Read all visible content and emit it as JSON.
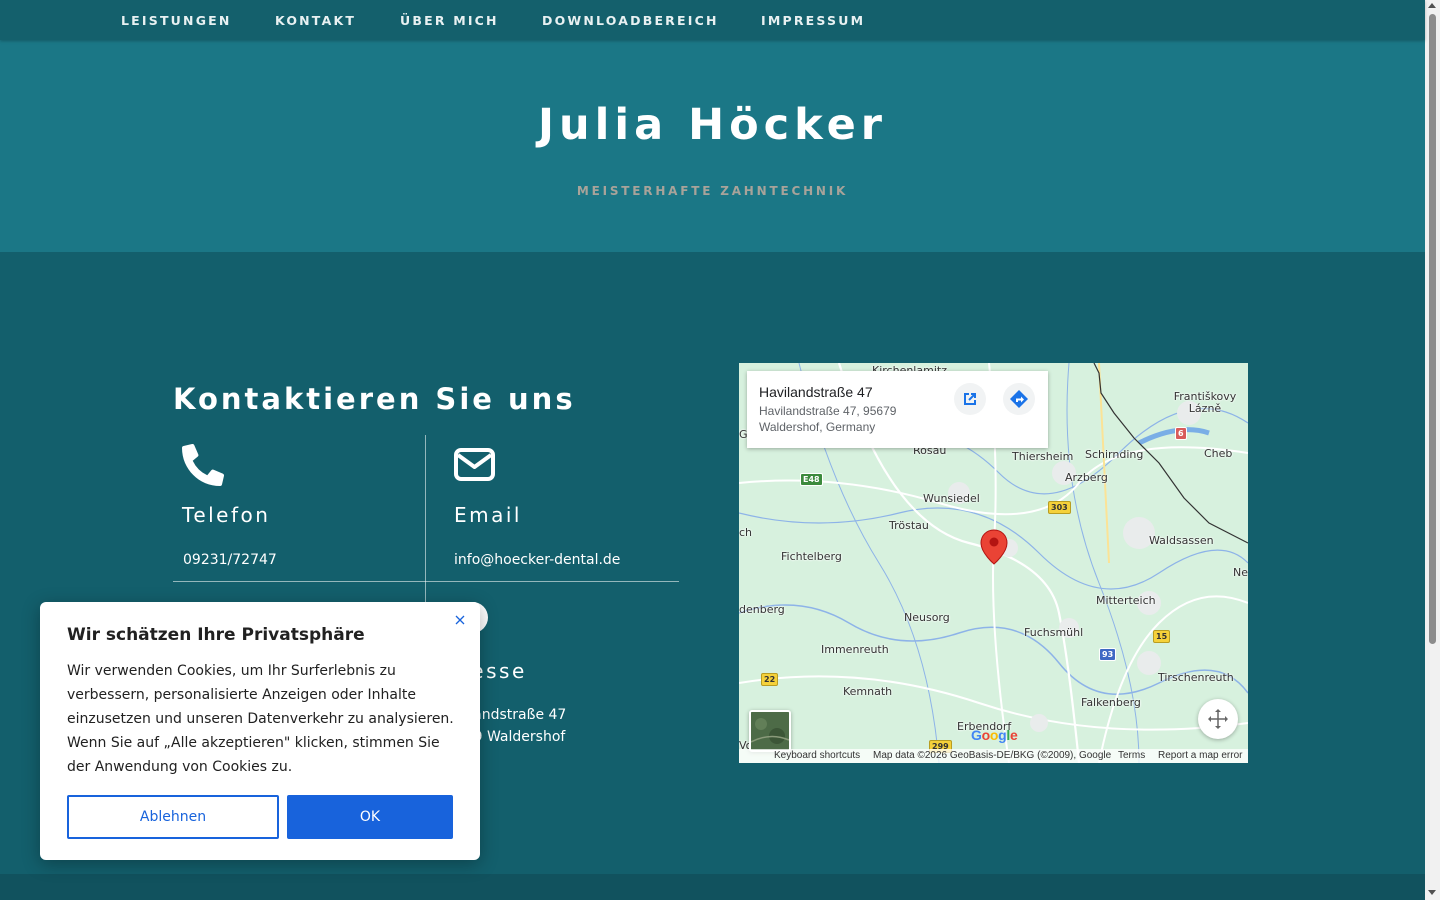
{
  "nav": {
    "items": [
      "LEISTUNGEN",
      "KONTAKT",
      "ÜBER MICH",
      "DOWNLOADBEREICH",
      "IMPRESSUM"
    ]
  },
  "hero": {
    "title": "Julia Höcker",
    "subtitle": "MEISTERHAFTE ZAHNTECHNIK"
  },
  "contact": {
    "title": "Kontaktieren Sie uns",
    "phone": {
      "icon": "phone-icon",
      "label": "Telefon",
      "value": "09231/72747"
    },
    "email": {
      "icon": "envelope-icon",
      "label": "Email",
      "value": "info@hoecker-dental.de"
    },
    "address": {
      "label": "Adresse",
      "line1": "Havilandstraße 47",
      "line2": "95679 Waldershof"
    }
  },
  "map": {
    "card": {
      "title": "Havilandstraße 47",
      "line1": "Havilandstraße 47, 95679",
      "line2": "Waldershof, Germany"
    },
    "places": [
      "Kirchenlamitz",
      "Františkovy Lázně",
      "Rosau",
      "Thiersheim",
      "Schirnding",
      "Cheb",
      "Arzberg",
      "Wunsiedel",
      "Tröstau",
      "Waldsassen",
      "Fichtelberg",
      "Mitterteich",
      "Neusorg",
      "Fuchsmühl",
      "Immenreuth",
      "Tirschenreuth",
      "Kemnath",
      "Falkenberg",
      "Erbendorf",
      "Ge",
      "ch",
      "denberg",
      "Ne",
      "Vo"
    ],
    "shields": [
      "E48",
      "303",
      "6",
      "15",
      "93",
      "22",
      "299"
    ],
    "footer": {
      "shortcuts": "Keyboard shortcuts",
      "data": "Map data ©2026 GeoBasis-DE/BKG (©2009), Google",
      "terms": "Terms",
      "report": "Report a map error"
    },
    "logo": "Google"
  },
  "cookie": {
    "title": "Wir schätzen Ihre Privatsphäre",
    "text": "Wir verwenden Cookies, um Ihr Surferlebnis zu verbessern, personalisierte Anzeigen oder Inhalte einzusetzen und unseren Datenverkehr zu analysieren. Wenn Sie auf „Alle akzeptieren\" klicken, stimmen Sie der Anwendung von Cookies zu.",
    "deny": "Ablehnen",
    "accept": "OK"
  },
  "colors": {
    "nav_bg": "#14606c",
    "hero_bg": "#1b7786",
    "main_bg": "#135f6c",
    "accent_button": "#1863dc"
  }
}
